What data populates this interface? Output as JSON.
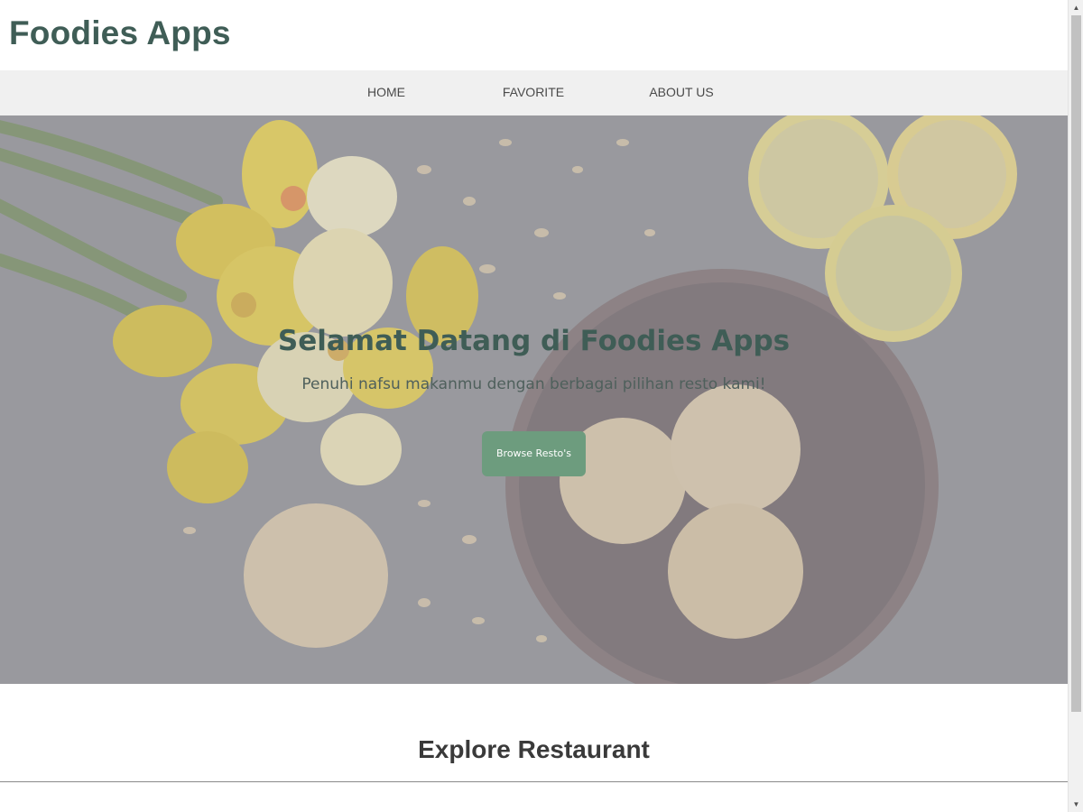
{
  "header": {
    "title": "Foodies Apps"
  },
  "nav": {
    "items": [
      "HOME",
      "FAVORITE",
      "ABOUT US"
    ]
  },
  "hero": {
    "title": "Selamat Datang di Foodies Apps",
    "subtitle": "Penuhi nafsu makanmu dengan berbagai pilihan resto kami!",
    "button_label": "Browse Resto's"
  },
  "content": {
    "section_title": "Explore Restaurant"
  },
  "scrollbar": {
    "up_icon": "▲",
    "down_icon": "▼"
  },
  "colors": {
    "brand": "#3f5d56",
    "nav_bg": "#f0f0f0",
    "button": "#6d9c7e",
    "hero_bg": "#8f9095"
  }
}
